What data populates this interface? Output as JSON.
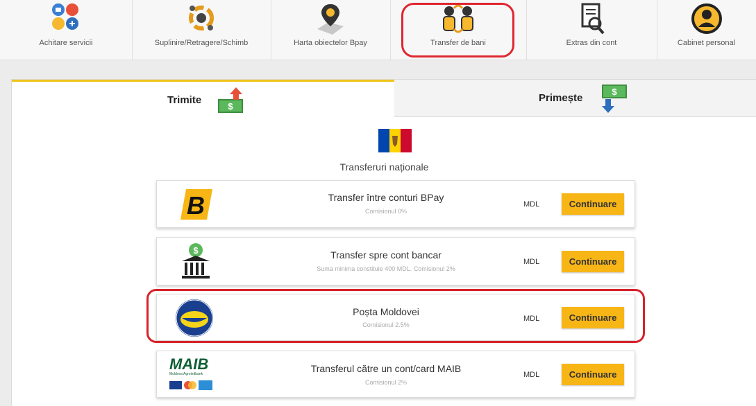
{
  "nav": {
    "items": [
      {
        "label": "Achitare servicii",
        "icon": "services-icon"
      },
      {
        "label": "Suplinire/Retragere/Schimb",
        "icon": "exchange-icon"
      },
      {
        "label": "Harta obiectelor Bpay",
        "icon": "map-pin-icon"
      },
      {
        "label": "Transfer de bani",
        "icon": "money-transfer-icon"
      },
      {
        "label": "Extras din cont",
        "icon": "statement-icon"
      },
      {
        "label": "Cabinet personal",
        "icon": "user-icon"
      }
    ],
    "active": "Transfer de bani"
  },
  "tabs": {
    "send": "Trimite",
    "receive": "Primește"
  },
  "section": {
    "title": "Transferuri naționale"
  },
  "transfers": [
    {
      "title": "Transfer între conturi BPay",
      "subtitle": "Comisionul 0%",
      "currency": "MDL",
      "button": "Continuare",
      "logo": "bpay-logo"
    },
    {
      "title": "Transfer spre cont bancar",
      "subtitle": "Suma minima constituie 400 MDL. Comisionul 2%",
      "currency": "MDL",
      "button": "Continuare",
      "logo": "bank-icon"
    },
    {
      "title": "Poșta Moldovei",
      "subtitle": "Comisionul 2.5%",
      "currency": "MDL",
      "button": "Continuare",
      "logo": "posta-moldovei-logo"
    },
    {
      "title": "Transferul către un cont/card MAIB",
      "subtitle": "Comisionul 2%",
      "currency": "MDL",
      "button": "Continuare",
      "logo": "maib-logo",
      "logo_text": "MAIB",
      "logo_subtext": "Moldova Agroindbank"
    }
  ],
  "colors": {
    "accent": "#f8b516",
    "highlight": "#e0262f",
    "tab_active_border": "#f0c419"
  }
}
